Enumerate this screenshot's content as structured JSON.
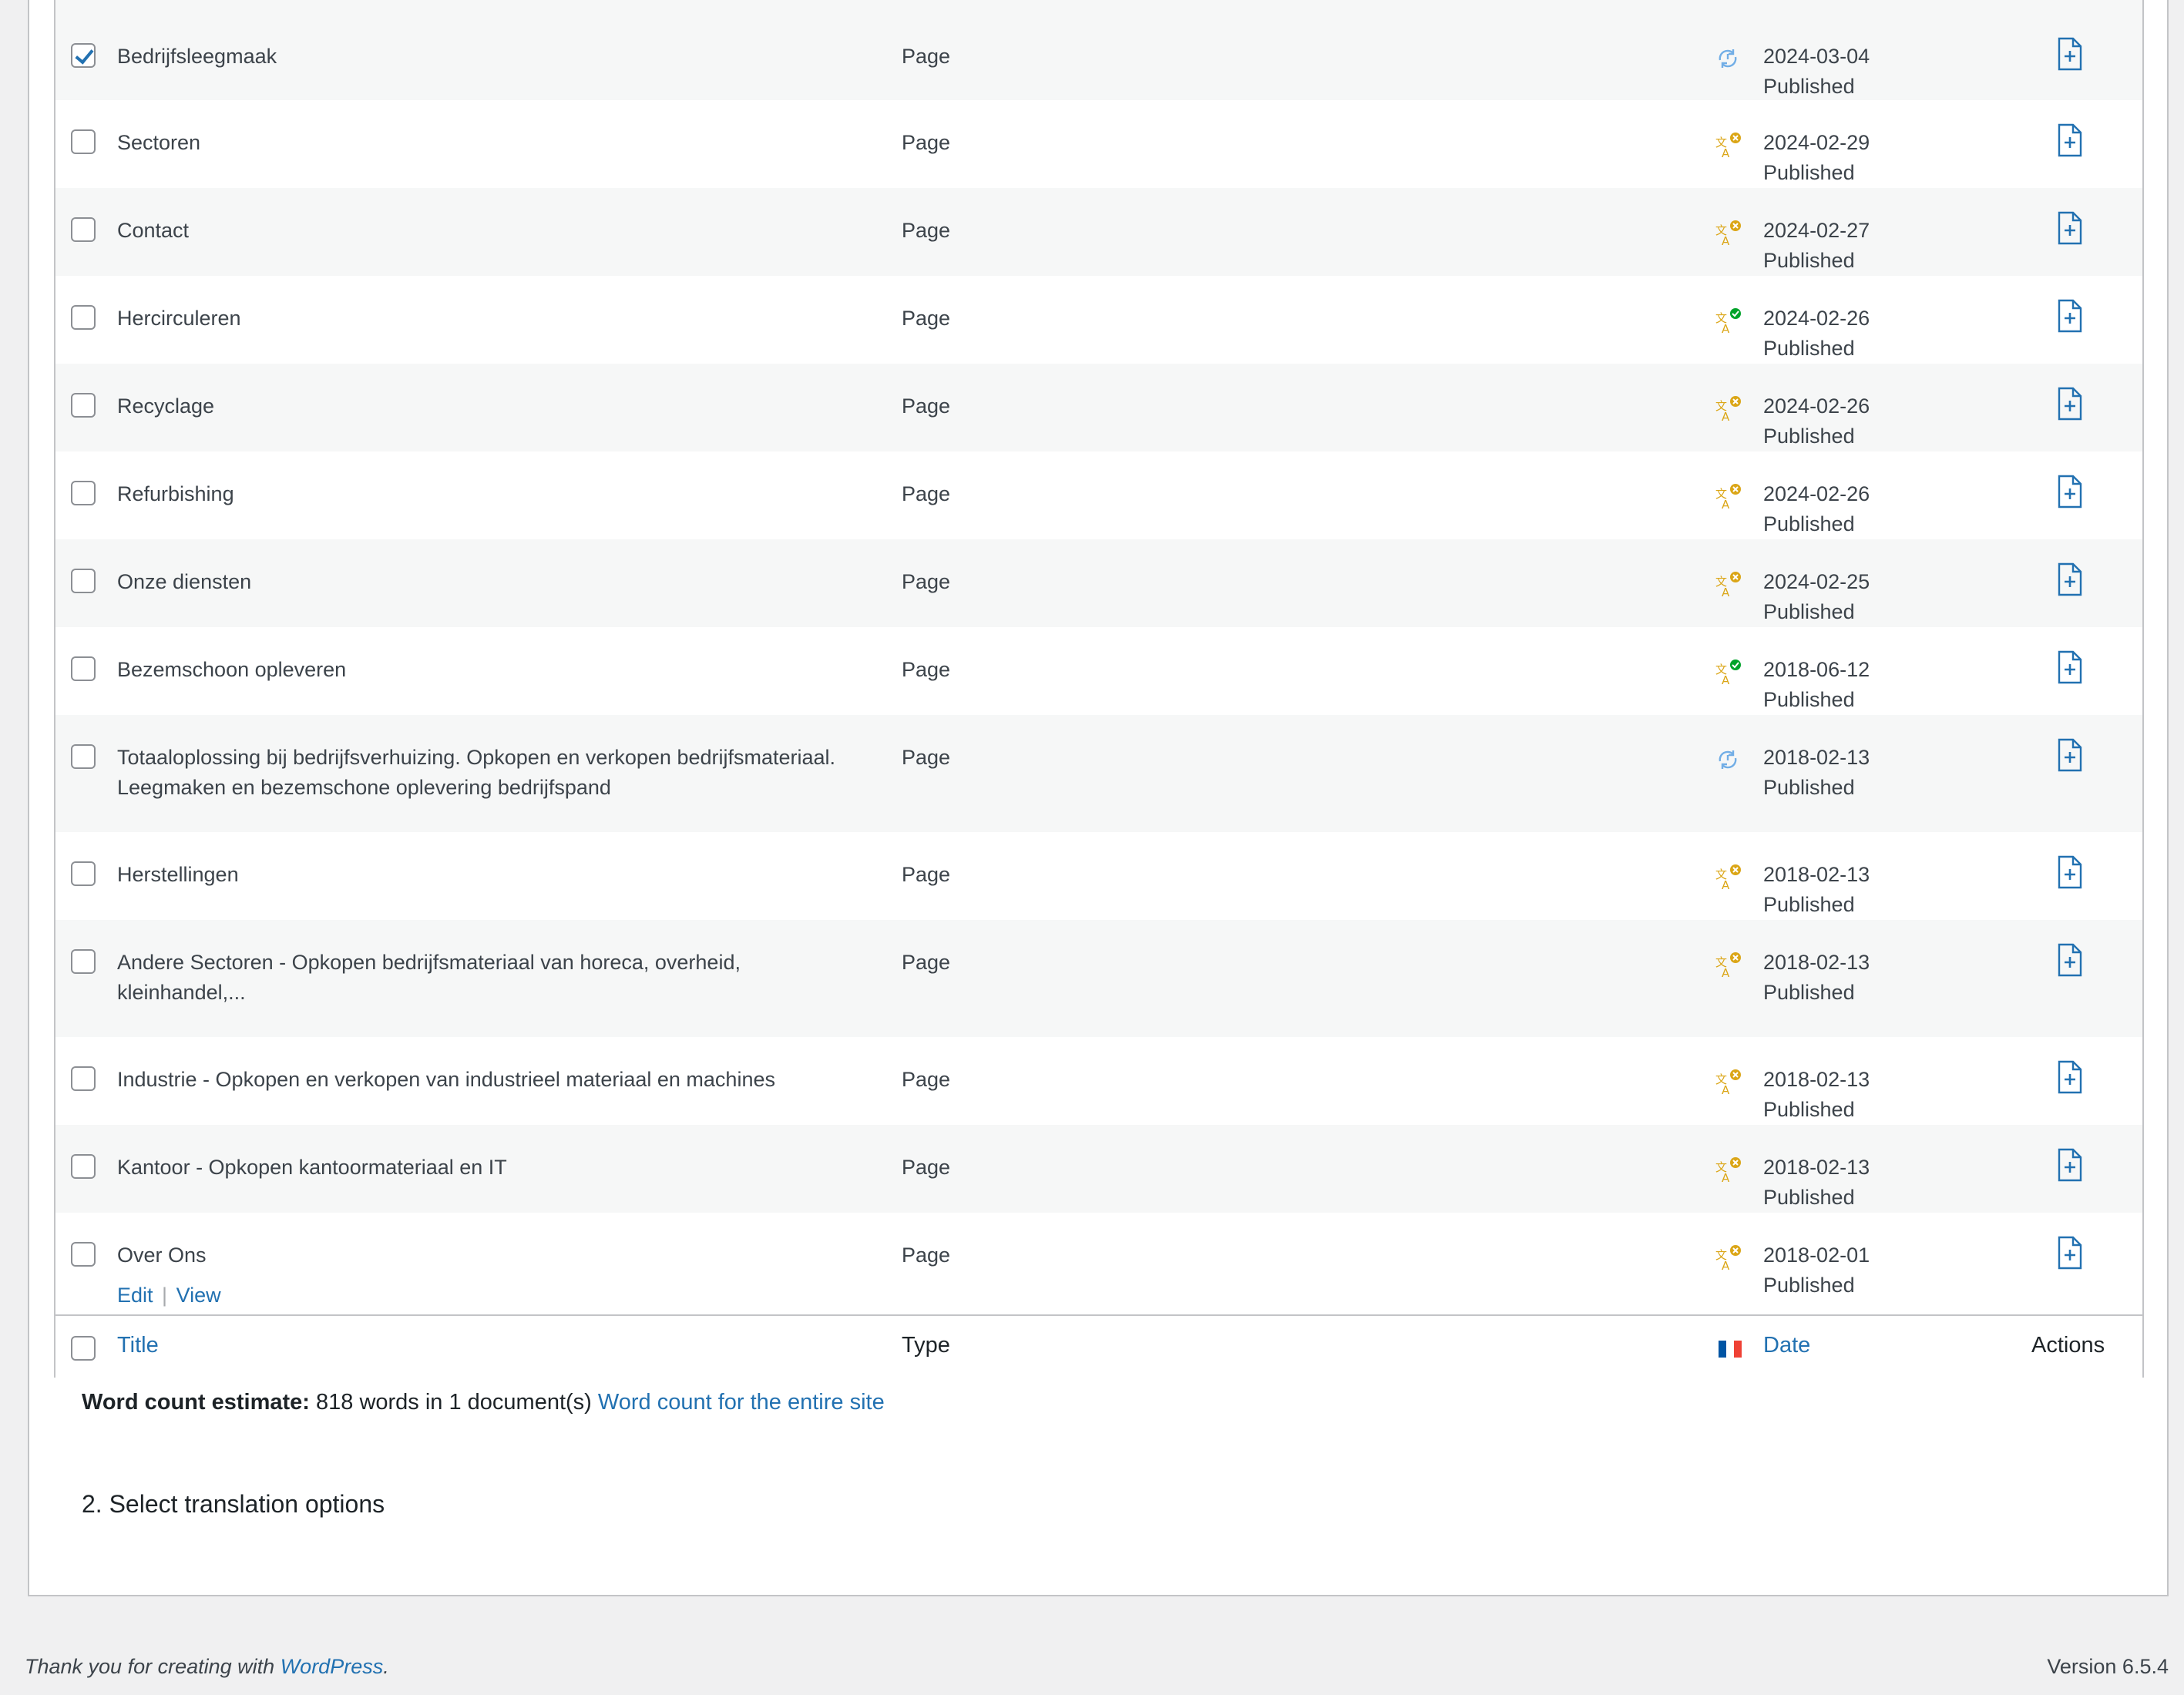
{
  "rows": [
    {
      "title": "Bedrijfsleegmaak",
      "title2": "",
      "type": "Page",
      "date": "2024-03-04",
      "status": "Published",
      "icon": "sync",
      "checked": true
    },
    {
      "title": "Sectoren",
      "title2": "",
      "type": "Page",
      "date": "2024-02-29",
      "status": "Published",
      "icon": "translate-x",
      "checked": false
    },
    {
      "title": "Contact",
      "title2": "",
      "type": "Page",
      "date": "2024-02-27",
      "status": "Published",
      "icon": "translate-x",
      "checked": false
    },
    {
      "title": "Hercirculeren",
      "title2": "",
      "type": "Page",
      "date": "2024-02-26",
      "status": "Published",
      "icon": "translate-check",
      "checked": false
    },
    {
      "title": "Recyclage",
      "title2": "",
      "type": "Page",
      "date": "2024-02-26",
      "status": "Published",
      "icon": "translate-x",
      "checked": false
    },
    {
      "title": "Refurbishing",
      "title2": "",
      "type": "Page",
      "date": "2024-02-26",
      "status": "Published",
      "icon": "translate-x",
      "checked": false
    },
    {
      "title": "Onze diensten",
      "title2": "",
      "type": "Page",
      "date": "2024-02-25",
      "status": "Published",
      "icon": "translate-x",
      "checked": false
    },
    {
      "title": "Bezemschoon opleveren",
      "title2": "",
      "type": "Page",
      "date": "2018-06-12",
      "status": "Published",
      "icon": "translate-check",
      "checked": false
    },
    {
      "title": "Totaaloplossing bij bedrijfsverhuizing. Opkopen en verkopen bedrijfsmateriaal.",
      "title2": "Leegmaken en bezemschone oplevering bedrijfspand",
      "type": "Page",
      "date": "2018-02-13",
      "status": "Published",
      "icon": "sync",
      "checked": false
    },
    {
      "title": "Herstellingen",
      "title2": "",
      "type": "Page",
      "date": "2018-02-13",
      "status": "Published",
      "icon": "translate-x",
      "checked": false
    },
    {
      "title": "Andere Sectoren - Opkopen bedrijfsmateriaal van horeca, overheid,",
      "title2": "kleinhandel,...",
      "type": "Page",
      "date": "2018-02-13",
      "status": "Published",
      "icon": "translate-x",
      "checked": false
    },
    {
      "title": "Industrie - Opkopen en verkopen van industrieel materiaal en machines",
      "title2": "",
      "type": "Page",
      "date": "2018-02-13",
      "status": "Published",
      "icon": "translate-x",
      "checked": false
    },
    {
      "title": "Kantoor - Opkopen kantoormateriaal en IT",
      "title2": "",
      "type": "Page",
      "date": "2018-02-13",
      "status": "Published",
      "icon": "translate-x",
      "checked": false
    },
    {
      "title": "Over Ons",
      "title2": "",
      "type": "Page",
      "date": "2018-02-01",
      "status": "Published",
      "icon": "translate-x",
      "checked": false
    }
  ],
  "row_actions": {
    "edit": "Edit",
    "sep": "|",
    "view": "View"
  },
  "columns": {
    "title": "Title",
    "type": "Type",
    "date": "Date",
    "actions": "Actions"
  },
  "wordcount": {
    "label": "Word count estimate:",
    "text": "818 words in 1 document(s)",
    "link": "Word count for the entire site"
  },
  "section2": "2. Select translation options",
  "footer": {
    "thanks": "Thank you for creating with",
    "wp": "WordPress",
    "dot": ".",
    "version": "Version 6.5.4"
  },
  "colors": {
    "link": "#2271b1",
    "orange": "#dba617",
    "green": "#00a32a",
    "sync": "#72aee6",
    "flag_blue": "#0055a4",
    "flag_red": "#ef4135"
  }
}
